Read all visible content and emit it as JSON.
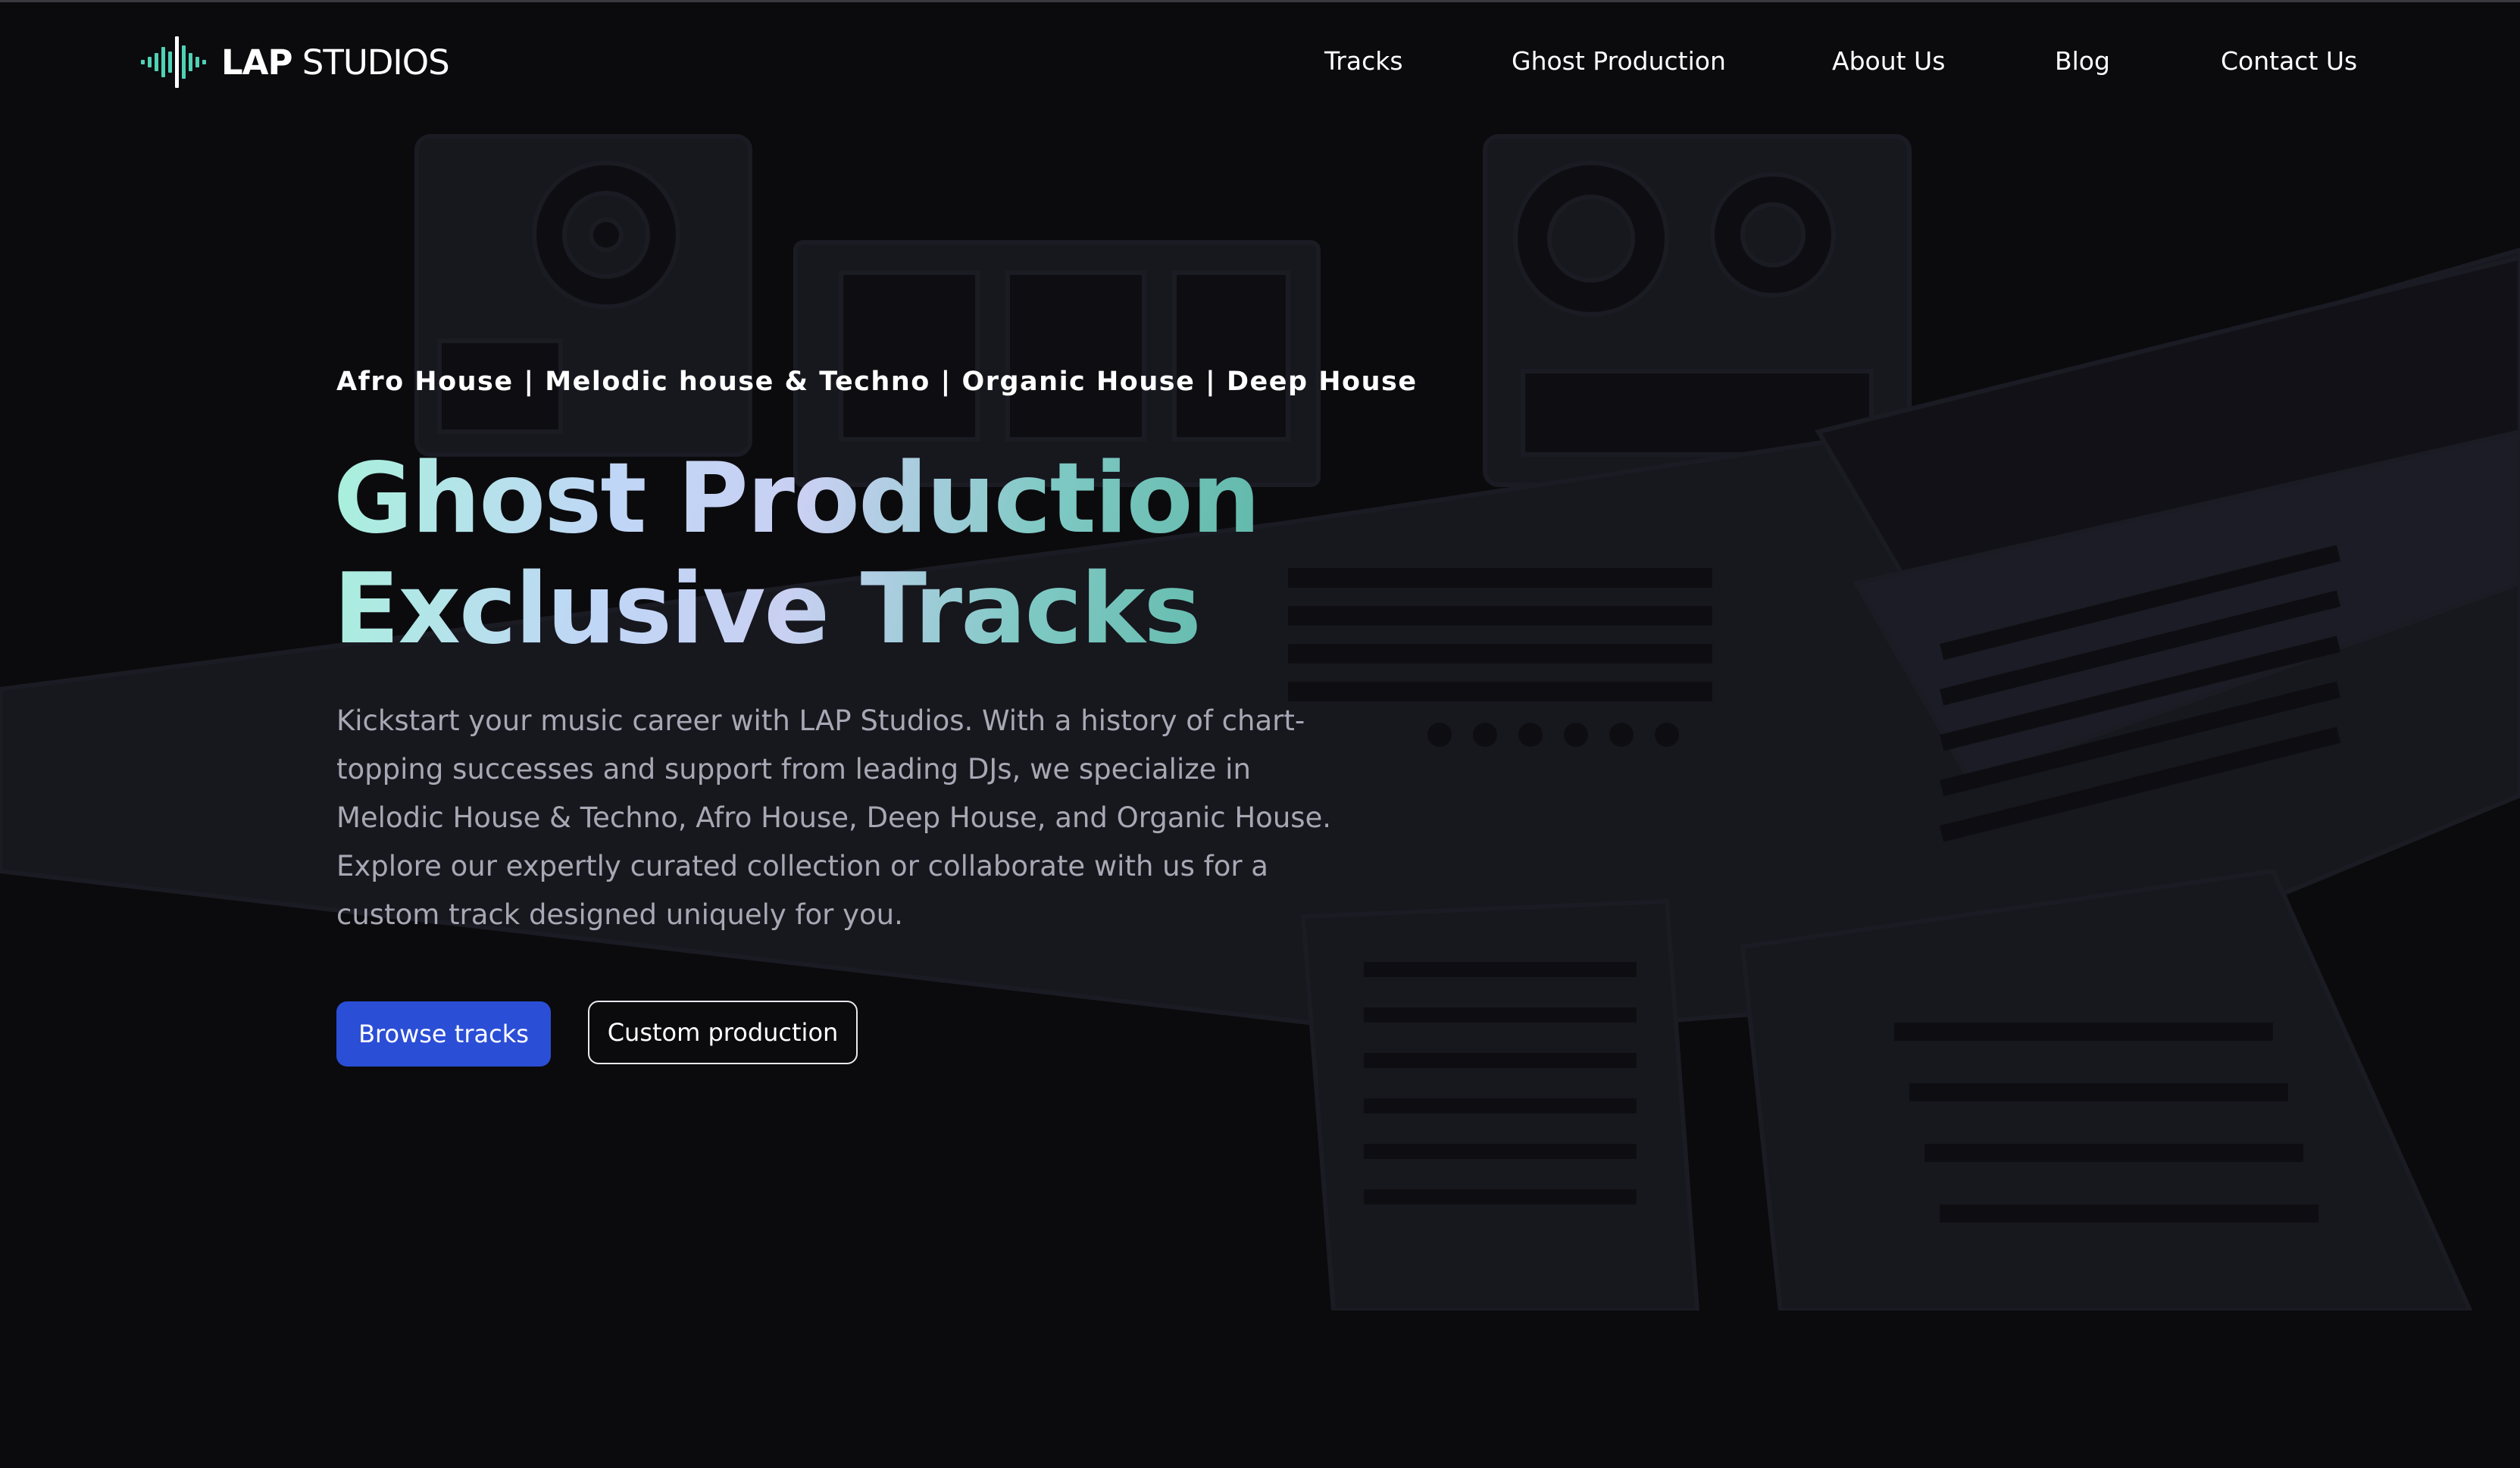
{
  "header": {
    "logo": {
      "strong": "LAP",
      "light": " STUDIOS"
    },
    "nav": [
      {
        "label": "Tracks"
      },
      {
        "label": "Ghost Production"
      },
      {
        "label": "About Us"
      },
      {
        "label": "Blog"
      },
      {
        "label": "Contact Us"
      }
    ]
  },
  "hero": {
    "genres": "Afro House | Melodic house & Techno | Organic House | Deep House",
    "headline_line1": "Ghost Production",
    "headline_line2": "Exclusive Tracks",
    "intro": "Kickstart your music career with LAP Studios. With a history of chart-topping successes and support from leading DJs, we specialize in Melodic House & Techno, Afro House, Deep House, and Organic House. Explore our expertly curated collection or collaborate with us for a custom track designed uniquely for you.",
    "primary_button": "Browse tracks",
    "secondary_button": "Custom production"
  },
  "colors": {
    "background": "#0b0b0d",
    "primary_button": "#2b4ed6",
    "headline_gradient": [
      "#a8f0dc",
      "#c0d6f6",
      "#c9d0f2",
      "#7fc9c4",
      "#5fb8a8"
    ],
    "body_text": "#a7a8b4",
    "logo_accent": "#4fd1b5"
  },
  "icons": {
    "logo_mark": "sound-wave-logo-icon"
  }
}
